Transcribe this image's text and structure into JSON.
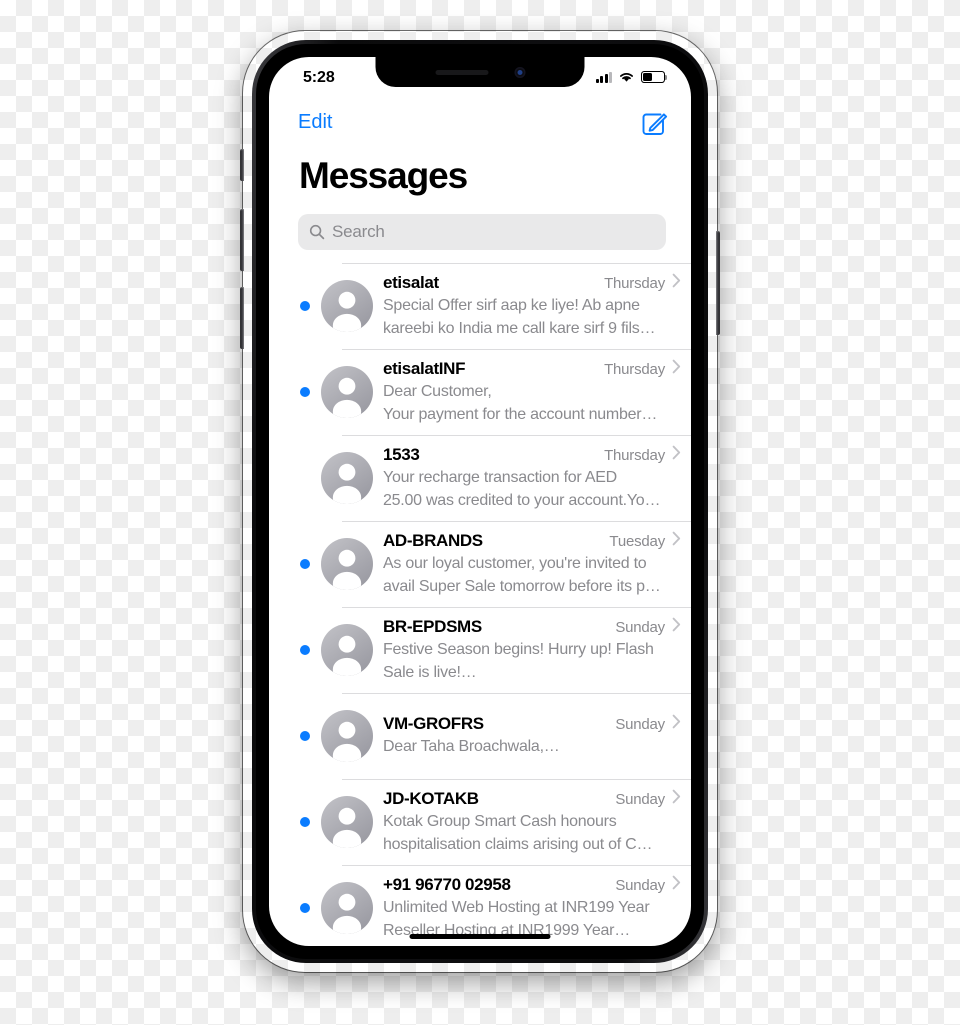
{
  "status_bar": {
    "time": "5:28",
    "signal_icon": "cellular-signal-icon",
    "signal_bars_filled": 3,
    "signal_bars_total": 4,
    "wifi_icon": "wifi-icon",
    "battery_icon": "battery-icon",
    "battery_level_percent": 40
  },
  "nav_bar": {
    "edit_label": "Edit",
    "compose_icon": "compose-icon"
  },
  "header": {
    "title": "Messages"
  },
  "search": {
    "placeholder": "Search",
    "value": "",
    "icon": "search-icon"
  },
  "colors": {
    "accent_blue": "#0a7cff",
    "unread_dot": "#0a7cff",
    "secondary_text": "#8a8a8e",
    "separator": "#dcdcde",
    "search_background": "#e9e9ea"
  },
  "conversations": [
    {
      "name": "etisalat",
      "time": "Thursday",
      "preview": "Special Offer sirf aap ke liye! Ab apne\nkareebi ko India me call kare sirf 9 fils…",
      "unread": true
    },
    {
      "name": "etisalatINF",
      "time": "Thursday",
      "preview": "Dear Customer,\nYour payment for the account number…",
      "unread": true
    },
    {
      "name": "1533",
      "time": "Thursday",
      "preview": "Your recharge transaction for AED\n25.00 was credited to your account.Yo…",
      "unread": false
    },
    {
      "name": "AD-BRANDS",
      "time": "Tuesday",
      "preview": "As our loyal customer, you're invited to\navail Super Sale tomorrow before its p…",
      "unread": true
    },
    {
      "name": "BR-EPDSMS",
      "time": "Sunday",
      "preview": "Festive Season begins! Hurry up! Flash\nSale is live!…",
      "unread": true
    },
    {
      "name": "VM-GROFRS",
      "time": "Sunday",
      "preview": "Dear Taha Broachwala,…",
      "unread": true
    },
    {
      "name": "JD-KOTAKB",
      "time": "Sunday",
      "preview": "Kotak Group Smart Cash honours\nhospitalisation claims arising out of C…",
      "unread": true
    },
    {
      "name": "+91 96770 02958",
      "time": "Sunday",
      "preview": "Unlimited Web Hosting at INR199 Year\nReseller Hosting at INR1999 Year…",
      "unread": true
    }
  ]
}
